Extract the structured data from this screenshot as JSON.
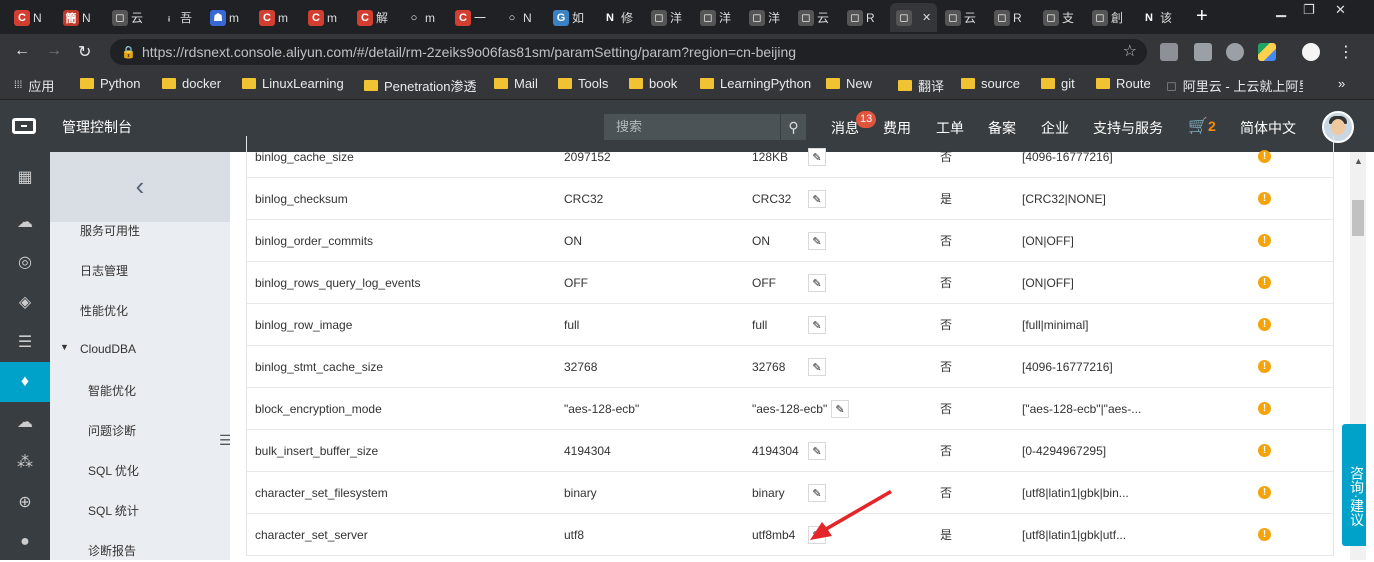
{
  "browser": {
    "tabs": [
      {
        "label": "N",
        "color": "#d23f31",
        "glyph": "C"
      },
      {
        "label": "N",
        "color": "#c0392b",
        "glyph": "簡"
      },
      {
        "label": "云",
        "color": "#555",
        "glyph": "◻"
      },
      {
        "label": "吾",
        "color": "#202124",
        "glyph": "ᵢ"
      },
      {
        "label": "m",
        "color": "#3867d6",
        "glyph": "☗"
      },
      {
        "label": "m",
        "color": "#d23f31",
        "glyph": "C"
      },
      {
        "label": "m",
        "color": "#d23f31",
        "glyph": "C"
      },
      {
        "label": "解",
        "color": "#d23f31",
        "glyph": "C"
      },
      {
        "label": "m",
        "color": "#202124",
        "glyph": "○"
      },
      {
        "label": "一",
        "color": "#d23f31",
        "glyph": "C"
      },
      {
        "label": "N",
        "color": "#202124",
        "glyph": "○"
      },
      {
        "label": "如",
        "color": "#3b82c4",
        "glyph": "G"
      },
      {
        "label": "修",
        "color": "#202124",
        "glyph": "N"
      },
      {
        "label": "洋",
        "color": "#555",
        "glyph": "◻"
      },
      {
        "label": "洋",
        "color": "#555",
        "glyph": "◻"
      },
      {
        "label": "洋",
        "color": "#555",
        "glyph": "◻"
      },
      {
        "label": "云",
        "color": "#555",
        "glyph": "◻"
      },
      {
        "label": "R",
        "color": "#555",
        "glyph": "◻"
      },
      {
        "label": "",
        "color": "#555",
        "glyph": "◻"
      },
      {
        "label": "云",
        "color": "#555",
        "glyph": "◻"
      },
      {
        "label": "R",
        "color": "#555",
        "glyph": "◻"
      },
      {
        "label": "支",
        "color": "#555",
        "glyph": "◻"
      },
      {
        "label": "創",
        "color": "#555",
        "glyph": "◻"
      },
      {
        "label": "该",
        "color": "#202124",
        "glyph": "N"
      }
    ],
    "url": "https://rdsnext.console.aliyun.com/#/detail/rm-2zeiks9o06fas81sm/paramSetting/param?region=cn-beijing",
    "bookmarks": [
      "应用",
      "Python",
      "docker",
      "LinuxLearning",
      "Penetration渗透",
      "Mail",
      "Tools",
      "book",
      "LearningPython",
      "New",
      "翻译",
      "source",
      "git",
      "Route",
      "阿里云 - 上云就上阿里"
    ]
  },
  "header": {
    "title": "管理控制台",
    "search_placeholder": "搜索",
    "messages": "消息",
    "message_count": "13",
    "links": [
      "费用",
      "工单",
      "备案",
      "企业",
      "支持与服务"
    ],
    "cart_count": "2",
    "language": "简体中文"
  },
  "sidebar": {
    "items": [
      "服务可用性",
      "日志管理",
      "性能优化",
      "CloudDBA",
      "智能优化",
      "问题诊断",
      "SQL 优化",
      "SQL 统计",
      "诊断报告"
    ]
  },
  "params": [
    {
      "name": "binlog_cache_size",
      "default": "2097152",
      "current": "128KB",
      "restart": "否",
      "range": "[4096-16777216]"
    },
    {
      "name": "binlog_checksum",
      "default": "CRC32",
      "current": "CRC32",
      "restart": "是",
      "range": "[CRC32|NONE]"
    },
    {
      "name": "binlog_order_commits",
      "default": "ON",
      "current": "ON",
      "restart": "否",
      "range": "[ON|OFF]"
    },
    {
      "name": "binlog_rows_query_log_events",
      "default": "OFF",
      "current": "OFF",
      "restart": "否",
      "range": "[ON|OFF]"
    },
    {
      "name": "binlog_row_image",
      "default": "full",
      "current": "full",
      "restart": "否",
      "range": "[full|minimal]"
    },
    {
      "name": "binlog_stmt_cache_size",
      "default": "32768",
      "current": "32768",
      "restart": "否",
      "range": "[4096-16777216]"
    },
    {
      "name": "block_encryption_mode",
      "default": "\"aes-128-ecb\"",
      "current": "\"aes-128-ecb\"",
      "restart": "否",
      "range": "[\"aes-128-ecb\"|\"aes-..."
    },
    {
      "name": "bulk_insert_buffer_size",
      "default": "4194304",
      "current": "4194304",
      "restart": "否",
      "range": "[0-4294967295]"
    },
    {
      "name": "character_set_filesystem",
      "default": "binary",
      "current": "binary",
      "restart": "否",
      "range": "[utf8|latin1|gbk|bin..."
    },
    {
      "name": "character_set_server",
      "default": "utf8",
      "current": "utf8mb4",
      "restart": "是",
      "range": "[utf8|latin1|gbk|utf..."
    }
  ],
  "consult": "咨询·建议"
}
